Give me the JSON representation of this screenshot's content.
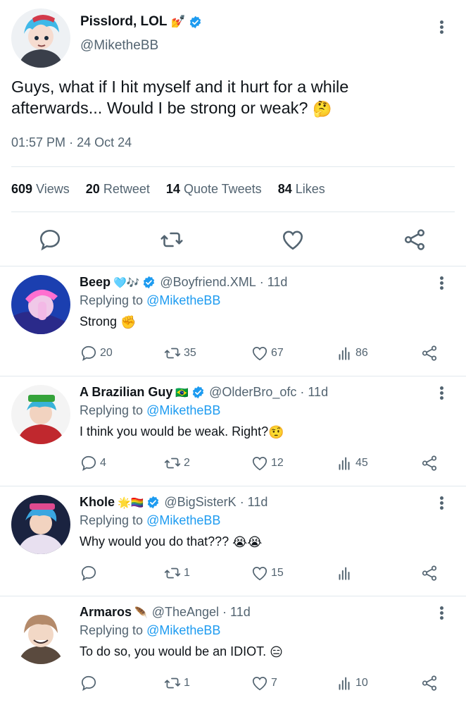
{
  "main_tweet": {
    "display_name": "Pisslord, LOL",
    "name_emoji": "💅",
    "handle": "@MiketheBB",
    "text_line1": "Guys, what if I hit myself and it hurt for a while",
    "text_line2": "afterwards... Would I be strong or weak?",
    "text_emoji": "🤔",
    "time": "01:57 PM",
    "separator": "·",
    "date": "24 Oct 24",
    "stats": {
      "views_count": "609",
      "views_label": "Views",
      "retweet_count": "20",
      "retweet_label": "Retweet",
      "quote_count": "14",
      "quote_label": "Quote Tweets",
      "likes_count": "84",
      "likes_label": "Likes"
    },
    "actions": [
      "reply-icon",
      "retweet-icon",
      "like-icon",
      "share-icon"
    ]
  },
  "replies": [
    {
      "name": "Beep",
      "name_emoji": "🩵🎶",
      "handle": "@Boyfriend.XML",
      "age": "· 11d",
      "replying_prefix": "Replying to",
      "replying_to": "@MiketheBB",
      "text": "Strong",
      "text_emoji": "✊",
      "reply_count": "20",
      "retweet_count": "35",
      "like_count": "67",
      "views_count": "86"
    },
    {
      "name": "A Brazilian Guy",
      "name_emoji": "🇧🇷",
      "handle": "@OlderBro_ofc",
      "age": "· 11d",
      "replying_prefix": "Replying to",
      "replying_to": "@MiketheBB",
      "text": "I think you would be weak. Right?",
      "text_emoji": "🤨",
      "reply_count": "4",
      "retweet_count": "2",
      "like_count": "12",
      "views_count": "45"
    },
    {
      "name": "Khole",
      "name_emoji": "🌟🏳️‍🌈",
      "handle": "@BigSisterK",
      "age": "· 11d",
      "replying_prefix": "Replying to",
      "replying_to": "@MiketheBB",
      "text": "Why would you do that???",
      "text_emoji": "😭😭",
      "reply_count": "",
      "retweet_count": "1",
      "like_count": "15",
      "views_count": ""
    },
    {
      "name": "Armaros",
      "name_emoji": "🪶",
      "handle": "@TheAngel",
      "age": "· 11d",
      "replying_prefix": "Replying to",
      "replying_to": "@MiketheBB",
      "text": "To do so, you would be an IDIOT.",
      "text_emoji": "😑",
      "reply_count": "",
      "retweet_count": "1",
      "like_count": "7",
      "views_count": "10"
    }
  ],
  "colors": {
    "accent": "#1d9bf0",
    "secondary_text": "#536471",
    "primary_text": "#0f1419",
    "divider": "#e1e8ed"
  }
}
